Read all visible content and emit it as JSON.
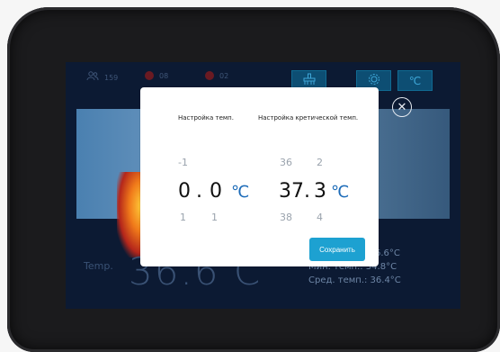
{
  "topbar": {
    "people_count": "159",
    "alert1_count": "08",
    "alert2_count": "02",
    "celsius_label": "℃"
  },
  "readout": {
    "temp_label": "Temp.",
    "temp_value": "36.6 C",
    "max_temp": "6.6°C",
    "min_temp": "Мин. темп.: 34.8°C",
    "avg_temp": "Сред. темп.: 36.4°C"
  },
  "dialog": {
    "left_title": "Настройка темп.",
    "right_title": "Настройка кретической темп.",
    "left_wheel": {
      "prev_int": "-1",
      "prev_dec": "",
      "int": "0",
      "sep": ".",
      "dec": "0",
      "next_int": "1",
      "next_dec": "1",
      "unit": "℃"
    },
    "right_wheel": {
      "prev_int": "36",
      "prev_dec": "2",
      "int": "37.",
      "dec": "3",
      "next_int": "38",
      "next_dec": "4",
      "unit": "℃"
    },
    "save_label": "Сохранить",
    "close_icon": "close-icon"
  },
  "colors": {
    "accent": "#1da1d1",
    "unit_blue": "#1c6bb8",
    "screen_bg": "#0c1a33"
  }
}
